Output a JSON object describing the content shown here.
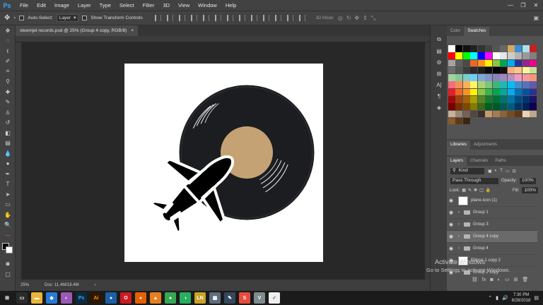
{
  "app": {
    "logo": "Ps"
  },
  "menu": [
    "File",
    "Edit",
    "Image",
    "Layer",
    "Type",
    "Select",
    "Filter",
    "3D",
    "View",
    "Window",
    "Help"
  ],
  "window_controls": [
    "—",
    "❐",
    "✕"
  ],
  "options_bar": {
    "auto_select_label": "Auto-Select:",
    "auto_select_value": "Layer",
    "show_transform_label": "Show Transform Controls",
    "mode_3d_label": "3D Mode:"
  },
  "document": {
    "tab_title": "steemjet records.psd @ 25% (Group 4 copy, RGB/8)",
    "close_glyph": "×"
  },
  "status": {
    "zoom": "25%",
    "doc_size": "Doc: 11.4M/18.4M",
    "arrow": "›"
  },
  "colors": {
    "record": "#1c1d20",
    "label": "#c4a273",
    "plane": "#000000"
  },
  "panels": {
    "color_tabs": [
      "Color",
      "Swatches"
    ],
    "library_tabs": [
      "Libraries",
      "Adjustments"
    ],
    "layer_tabs": [
      "Layers",
      "Channels",
      "Paths"
    ],
    "kind_label": "Kind",
    "blend_mode": "Pass Through",
    "opacity_label": "Opacity:",
    "opacity_value": "100%",
    "lock_label": "Lock:",
    "fill_label": "Fill:",
    "fill_value": "100%"
  },
  "swatches": [
    "#ffffff",
    "#000000",
    "#111111",
    "#222222",
    "#333333",
    "#444444",
    "#555555",
    "#666666",
    "#d4a861",
    "#3a8fd9",
    "#a9e0f0",
    "#cc1e1e",
    "#ff0000",
    "#ffff00",
    "#00ff00",
    "#00ffff",
    "#0000ff",
    "#ff00ff",
    "#ffffff",
    "#e6e6e6",
    "#cccccc",
    "#b3b3b3",
    "#999999",
    "#808080",
    "#a3a3a3",
    "#5e5e5e",
    "#4a4a4a",
    "#f26522",
    "#f7941d",
    "#fff200",
    "#8dc63f",
    "#00a651",
    "#00aeef",
    "#2e3192",
    "#92278f",
    "#ec008c",
    "#6d6d6d",
    "#555555",
    "#3c3c3c",
    "#2a2a2a",
    "#1e1e1e",
    "#0c0c0c",
    "#000000",
    "#111111",
    "#f9ad81",
    "#fdc68a",
    "#fff799",
    "#c4df9b",
    "#a3d39c",
    "#82ca9c",
    "#7bcdc8",
    "#6ecff6",
    "#7ea7d8",
    "#8493ca",
    "#8882be",
    "#a187be",
    "#bc8dbf",
    "#f49ac2",
    "#f6989d",
    "#f7977a",
    "#f26d7d",
    "#f68e56",
    "#fbaf5d",
    "#fff467",
    "#acd373",
    "#7cc576",
    "#3bb878",
    "#1abbb4",
    "#00bff3",
    "#438ccb",
    "#5574b9",
    "#605ca8",
    "#ed1c24",
    "#f26522",
    "#f7941d",
    "#fff200",
    "#8dc63f",
    "#39b54a",
    "#00a651",
    "#00a99d",
    "#00aeef",
    "#0072bc",
    "#0054a6",
    "#2e3192",
    "#9e0b0f",
    "#a0410d",
    "#a36209",
    "#aba000",
    "#598527",
    "#1a7b30",
    "#007236",
    "#00746b",
    "#0076a3",
    "#004b80",
    "#003471",
    "#1b1464",
    "#790000",
    "#7b2e00",
    "#7d4900",
    "#827b00",
    "#406618",
    "#005e20",
    "#005826",
    "#005952",
    "#005b7f",
    "#003663",
    "#002157",
    "#0d004c",
    "#c7b299",
    "#998675",
    "#736357",
    "#534741",
    "#37302d",
    "#c69c6d",
    "#a67c52",
    "#8c6239",
    "#754c24",
    "#603913",
    "#e8d3b9",
    "#bfa98a",
    "#8b5a2b",
    "#5c3a1a",
    "#3b2512"
  ],
  "layers": [
    {
      "name": "plane-icon (1)",
      "kind": "thumb"
    },
    {
      "name": "Group 1",
      "kind": "folder"
    },
    {
      "name": "Group 3",
      "kind": "folder"
    },
    {
      "name": "Group 4 copy",
      "kind": "folder",
      "selected": true
    },
    {
      "name": "Group 4",
      "kind": "folder"
    },
    {
      "name": "Ellipse 1 copy 2",
      "kind": "thumb"
    },
    {
      "name": "Group 2 copy",
      "kind": "folder"
    }
  ],
  "taskbar": {
    "apps": [
      {
        "name": "start",
        "label": "⊞",
        "color": "#1b1b1b"
      },
      {
        "name": "task-view",
        "label": "▭",
        "color": "#2b2b2b"
      },
      {
        "name": "file-explorer",
        "label": "▬",
        "color": "#e8b53a"
      },
      {
        "name": "store",
        "label": "◆",
        "color": "#2a7ad5"
      },
      {
        "name": "paint3d",
        "label": "◐",
        "color": "#9b59b6"
      },
      {
        "name": "photoshop",
        "label": "Ps",
        "color": "#0d2a3e"
      },
      {
        "name": "illustrator",
        "label": "Ai",
        "color": "#2e1600"
      },
      {
        "name": "app-blue",
        "label": "●",
        "color": "#1d5fa6"
      },
      {
        "name": "opera",
        "label": "O",
        "color": "#cc1b22"
      },
      {
        "name": "firefox",
        "label": "●",
        "color": "#e66000"
      },
      {
        "name": "vlc",
        "label": "▲",
        "color": "#e67e22"
      },
      {
        "name": "chrome",
        "label": "●",
        "color": "#34a853"
      },
      {
        "name": "app-green",
        "label": "◑",
        "color": "#27ae60"
      },
      {
        "name": "ln-app",
        "label": "LN",
        "color": "#c9a227"
      },
      {
        "name": "app-grey",
        "label": "▦",
        "color": "#5d6d7e"
      },
      {
        "name": "app-paint",
        "label": "✎",
        "color": "#34495e"
      },
      {
        "name": "smartscreen",
        "label": "S",
        "color": "#e74c3c"
      },
      {
        "name": "app-v",
        "label": "V",
        "color": "#7f8c8d"
      },
      {
        "name": "app-check",
        "label": "✓",
        "color": "#ecf0f1"
      }
    ],
    "time": "7:30 PM",
    "date": "8/28/2018"
  },
  "watermark": {
    "line1": "Activate Windows",
    "line2": "Go to Settings to activate Windows."
  }
}
